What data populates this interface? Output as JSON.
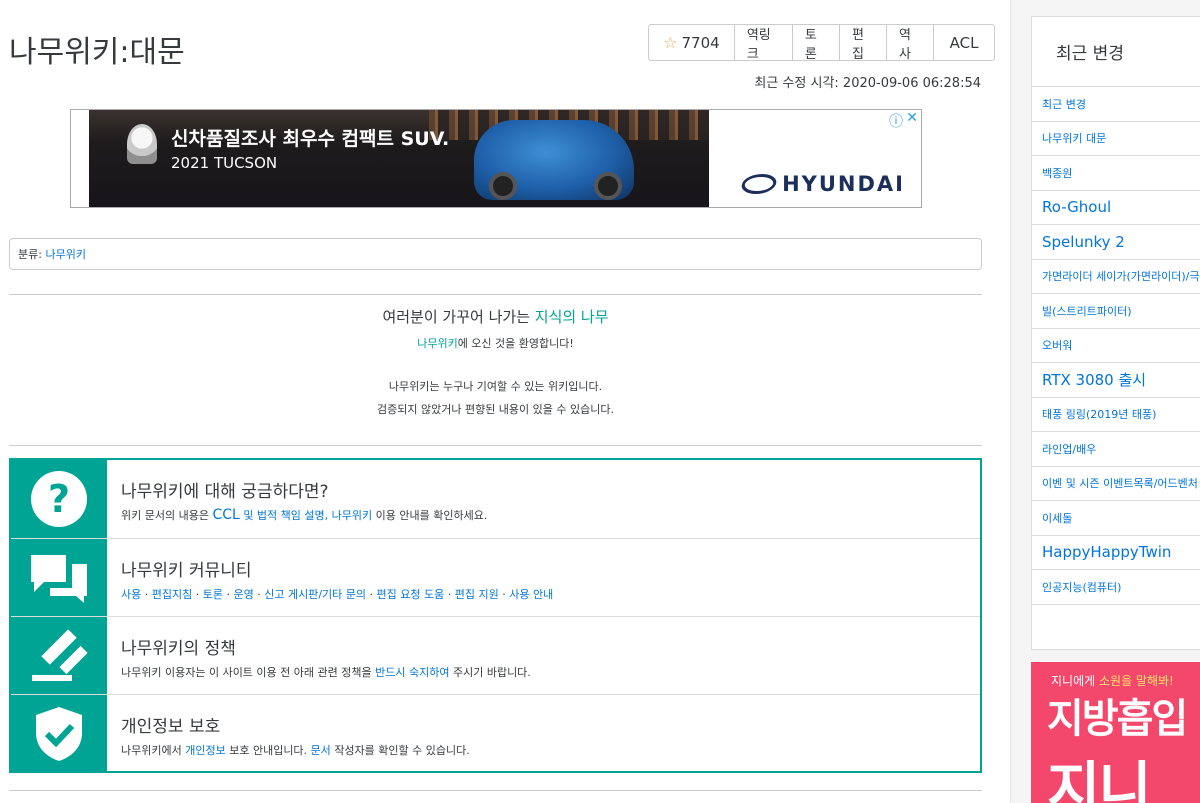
{
  "page": {
    "title": "나무위키:대문",
    "last_modified_label": "최근 수정 시각:",
    "last_modified_value": "2020-09-06 06:28:54"
  },
  "toolbar": {
    "star_icon": "☆",
    "star_count": "7704",
    "edit_request": "역링크",
    "discussion": "토론",
    "edit": "편집",
    "history": "역사",
    "acl": "ACL"
  },
  "ad": {
    "headline": "신차품질조사 최우수 컴팩트 SUV.",
    "model": "2021 TUCSON",
    "logo": "HYUNDAI",
    "info_icon": "ⓘ",
    "close_icon": "✕"
  },
  "category": {
    "label": "분류:",
    "value": "나무위키"
  },
  "notice": {
    "head_text": "여러분이 가꾸어 나가는",
    "head_link": "지식의 나무",
    "sub_link": "나무위키",
    "sub_text": "에 오신 것을 환영합니다!",
    "line1": "나무위키는 누구나 기여할 수 있는 위키입니다.",
    "line2": "검증되지 않았거나 편향된 내용이 있을 수 있습니다."
  },
  "info": [
    {
      "icon": "question-icon",
      "title": "나무위키에 대해 궁금하다면?",
      "desc_prefix": "위키 문서의 내용은",
      "desc_ccl": "CCL",
      "desc_mid": "및 법적 책임 설명,",
      "desc_link": "나무위키",
      "desc_suffix": "이용 안내를 확인하세요."
    },
    {
      "icon": "chat-icon",
      "title": "나무위키 커뮤니티",
      "links": [
        "사용",
        "편집지침",
        "토론",
        "운영",
        "신고 게시판/기타 문의",
        "편집 요청 도움",
        "편집 지원",
        "사용 안내"
      ]
    },
    {
      "icon": "gavel-icon",
      "title": "나무위키의 정책",
      "desc_prefix": "나무위키 이용자는 이 사이트 이용 전 아래 관련 정책을",
      "desc_link": "반드시 숙지하여",
      "desc_suffix": "주시기 바랍니다."
    },
    {
      "icon": "shield-icon",
      "title": "개인정보 보호",
      "desc_prefix": "나무위키에서",
      "desc_link1": "개인정보",
      "desc_mid": "보호 안내입니다.",
      "desc_link2": "문서",
      "desc_suffix": "작성자를 확인할 수 있습니다."
    }
  ],
  "sidebar": {
    "title": "최근 변경",
    "items": [
      {
        "label": "최근 변경",
        "big": false
      },
      {
        "label": "나무위키 대문",
        "big": false
      },
      {
        "label": "백종원",
        "big": false
      },
      {
        "label": "Ro-Ghoul",
        "big": true
      },
      {
        "label": "Spelunky 2",
        "big": true
      },
      {
        "label": "가면라이더 세이가(가면라이더)/극",
        "big": false
      },
      {
        "label": "빌(스트리트파이터)",
        "big": false
      },
      {
        "label": "오버워",
        "big": false
      },
      {
        "label": "RTX 3080 출시",
        "big": true
      },
      {
        "label": "태풍 링링(2019년 태풍)",
        "big": false
      },
      {
        "label": "라인업/배우",
        "big": false
      },
      {
        "label": "이벤 및 시즌 이벤트목록/어드벤처",
        "big": false
      },
      {
        "label": "이세돌",
        "big": false
      },
      {
        "label": "HappyHappyTwin",
        "big": true
      },
      {
        "label": "인공지능(컴퓨터)",
        "big": false
      }
    ]
  },
  "side_ad": {
    "small_prefix": "지니에게",
    "small_highlight": "소원을 말해봐!",
    "big1": "지방흡입",
    "big2": "지니"
  }
}
